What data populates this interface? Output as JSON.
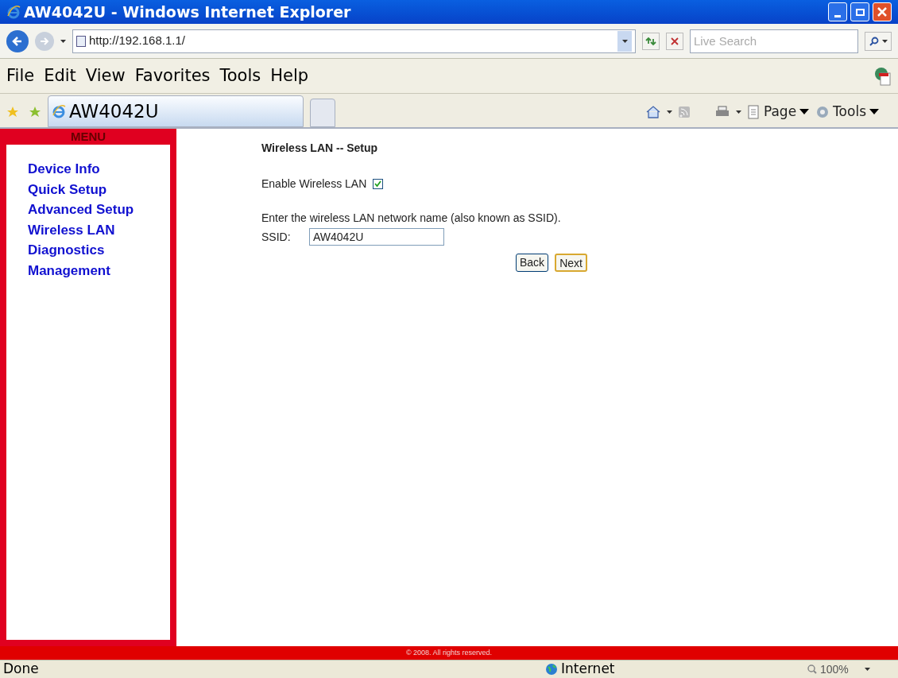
{
  "window": {
    "title": "AW4042U - Windows Internet Explorer"
  },
  "address_bar": {
    "url": "http://192.168.1.1/"
  },
  "search": {
    "placeholder": "Live Search"
  },
  "menu_bar": [
    "File",
    "Edit",
    "View",
    "Favorites",
    "Tools",
    "Help"
  ],
  "tab": {
    "title": "AW4042U",
    "selected": true
  },
  "command_bar": [
    {
      "kind": "page",
      "label": "Page"
    },
    {
      "kind": "tools",
      "label": "Tools"
    }
  ],
  "sidebar": {
    "title": "MENU",
    "items": [
      "Device Info",
      "Quick Setup",
      "Advanced Setup",
      "Wireless LAN",
      "Diagnostics",
      "Management"
    ]
  },
  "content": {
    "heading": "Wireless LAN -- Setup",
    "enable": {
      "label": "Enable Wireless LAN",
      "checked": true
    },
    "instruction": "Enter the wireless LAN network name (also known as SSID).",
    "ssid": {
      "label": "SSID:",
      "value": "AW4042U"
    },
    "buttons": [
      {
        "label": "Back",
        "kind": "normal"
      },
      {
        "label": "Next",
        "kind": "default"
      }
    ]
  },
  "footer": "© 2008. All rights reserved.",
  "status_bar": {
    "status": "Done",
    "zone": "Internet",
    "zoom": "100%"
  }
}
